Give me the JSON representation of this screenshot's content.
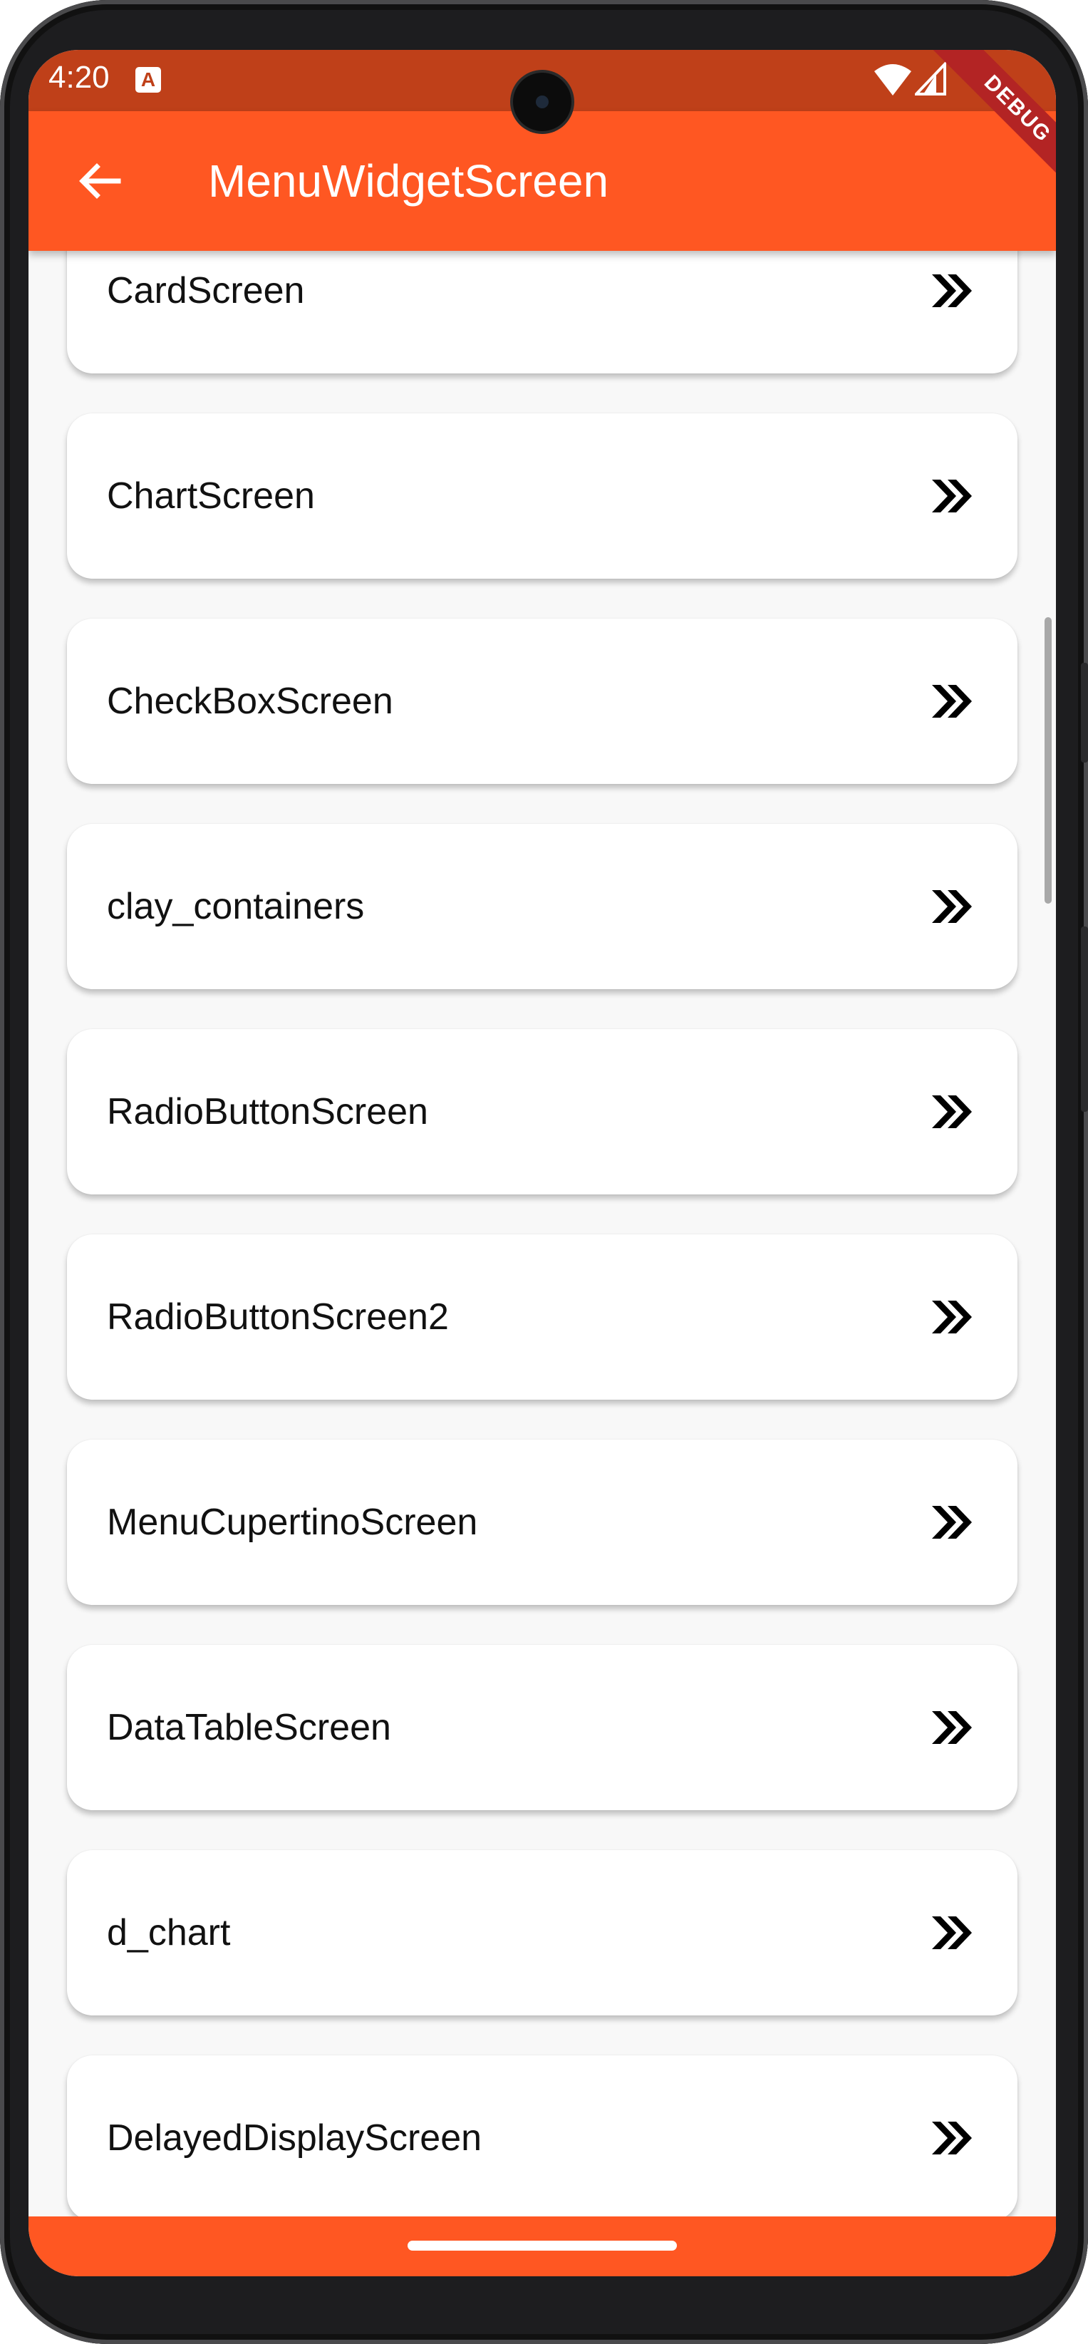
{
  "status_bar": {
    "time": "4:20",
    "notification_icon": "A",
    "debug_label": "DEBUG",
    "wifi_icon": "wifi-icon",
    "signal_icon": "signal-icon"
  },
  "app_bar": {
    "title": "MenuWidgetScreen",
    "back_icon": "arrow-left-icon"
  },
  "list": {
    "items": [
      {
        "label": "CardScreen"
      },
      {
        "label": "ChartScreen"
      },
      {
        "label": "CheckBoxScreen"
      },
      {
        "label": "clay_containers"
      },
      {
        "label": "RadioButtonScreen"
      },
      {
        "label": "RadioButtonScreen2"
      },
      {
        "label": "MenuCupertinoScreen"
      },
      {
        "label": "DataTableScreen"
      },
      {
        "label": "d_chart"
      },
      {
        "label": "DelayedDisplayScreen"
      }
    ],
    "trailing_icon": "double-chevron-right-icon"
  },
  "colors": {
    "status_bar": "#bf4019",
    "app_bar": "#ff5722",
    "background": "#f8f8f8",
    "card": "#ffffff",
    "debug_banner": "#b32424"
  }
}
